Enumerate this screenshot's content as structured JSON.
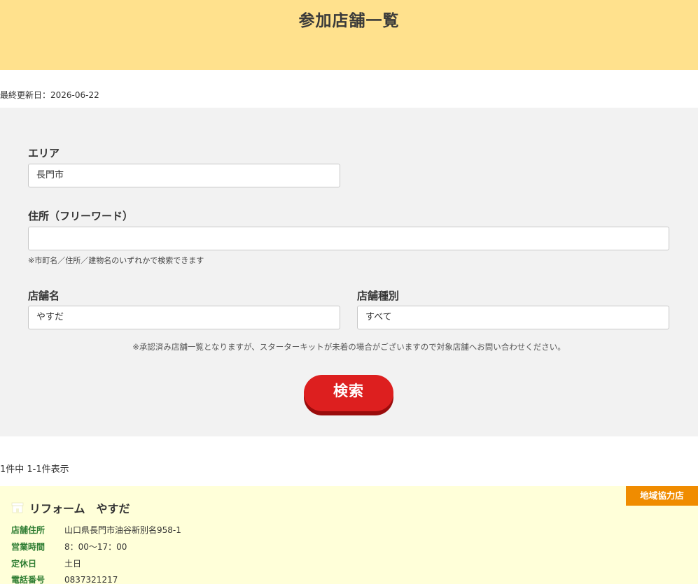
{
  "header": {
    "title": "参加店舗一覧"
  },
  "updated": {
    "text": "最終更新日：2026-06-22"
  },
  "search": {
    "area_label": "エリア",
    "area_value": "長門市",
    "address_label": "住所（フリーワード）",
    "address_value": "",
    "address_hint": "※市町名／住所／建物名のいずれかで検索できます",
    "shop_name_label": "店舗名",
    "shop_name_value": "やすだ",
    "shop_type_label": "店舗種別",
    "shop_type_value": "すべて",
    "notice": "※承認済み店舗一覧となりますが、スターターキットが未着の場合がございますので対象店舗へお問い合わせください。",
    "submit_label": "検索"
  },
  "results": {
    "count_text": "1件中 1-1件表示",
    "items": [
      {
        "badge": "地域協力店",
        "icon": "store-icon",
        "name": "リフォーム　やすだ",
        "address_label": "店舗住所",
        "address": "山口県長門市油谷新別名958-1",
        "hours_label": "営業時間",
        "hours": "8：00〜17：00",
        "holiday_label": "定休日",
        "holiday": "土日",
        "phone_label": "電話番号",
        "phone": "0837321217"
      }
    ]
  },
  "colors": {
    "header_bg": "#ffe18d",
    "panel_bg": "#f2f2f2",
    "button_red": "#dd1f1f",
    "badge_orange": "#f08c00",
    "card_bg": "#ffffd9",
    "label_green": "#2e7d32"
  }
}
